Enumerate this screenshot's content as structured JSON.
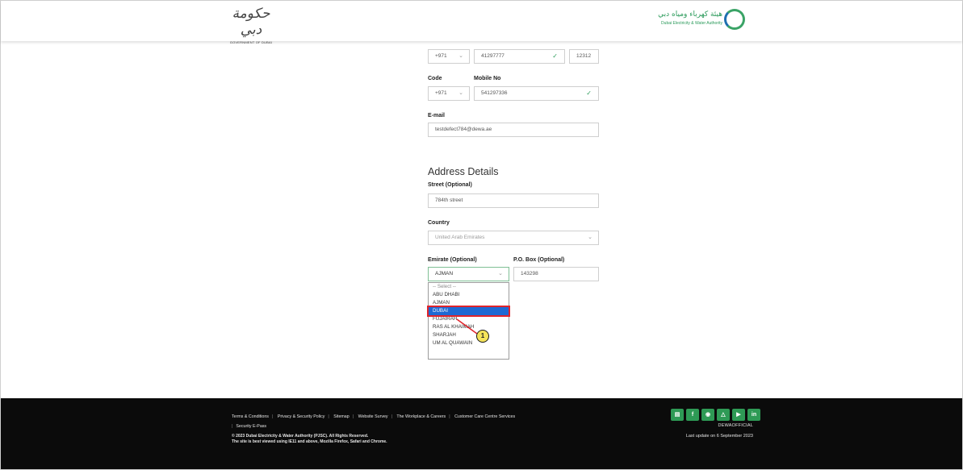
{
  "header": {
    "gov_logo_script": "حكومة دبي",
    "gov_logo_sub": "GOVERNMENT OF DUBAI",
    "dewa_logo_ar": "هيئة كهرباء ومياه دبي",
    "dewa_logo_en": "Dubai Electricity & Water Authority"
  },
  "phone": {
    "code": "+971",
    "number": "41297777",
    "extension": "12312"
  },
  "mobile": {
    "code_label": "Code",
    "number_label": "Mobile No",
    "code": "+971",
    "number": "541297336"
  },
  "email": {
    "label": "E-mail",
    "value": "testdefect784@dewa.ae"
  },
  "address": {
    "title": "Address Details",
    "street_label": "Street (Optional)",
    "street_value": "784th street",
    "country_label": "Country",
    "country_value": "United Arab Emirates",
    "emirate_label": "Emirate (Optional)",
    "emirate_value": "AJMAN",
    "pobox_label": "P.O. Box (Optional)",
    "pobox_value": "143298"
  },
  "emirate_options": [
    "-- Select --",
    "ABU DHABI",
    "AJMAN",
    "DUBAI",
    "FUJAIRAH",
    "RAS AL KHAIMAH",
    "SHARJAH",
    "UM AL QUAWAIN"
  ],
  "highlighted_option": "DUBAI",
  "callout": {
    "number": "1",
    "color": "#f4e35a",
    "border": "#e0242b"
  },
  "footer": {
    "links": [
      "Terms & Conditions",
      "Privacy & Security Policy",
      "Sitemap",
      "Website Survey",
      "The Workplace & Careers",
      "Customer Care Centre Services",
      "Security E-Pass"
    ],
    "copyright_1": "© 2023 Dubai Electricity & Water Authority (PJSC). All Rights Reserved.",
    "copyright_2": "The site is best viewed using IE11 and above, Mozilla Firefox, Safari and Chrome.",
    "social_icons": [
      "blog-icon",
      "facebook-icon",
      "instagram-icon",
      "snapchat-icon",
      "youtube-icon",
      "linkedin-icon"
    ],
    "handle": "DEWAOFFICIAL",
    "last_update": "Last update on 6 September 2023"
  },
  "colors": {
    "accent_green": "#2e9a55",
    "select_blue": "#1e69d3",
    "footer_bg": "#0b0b0b"
  }
}
